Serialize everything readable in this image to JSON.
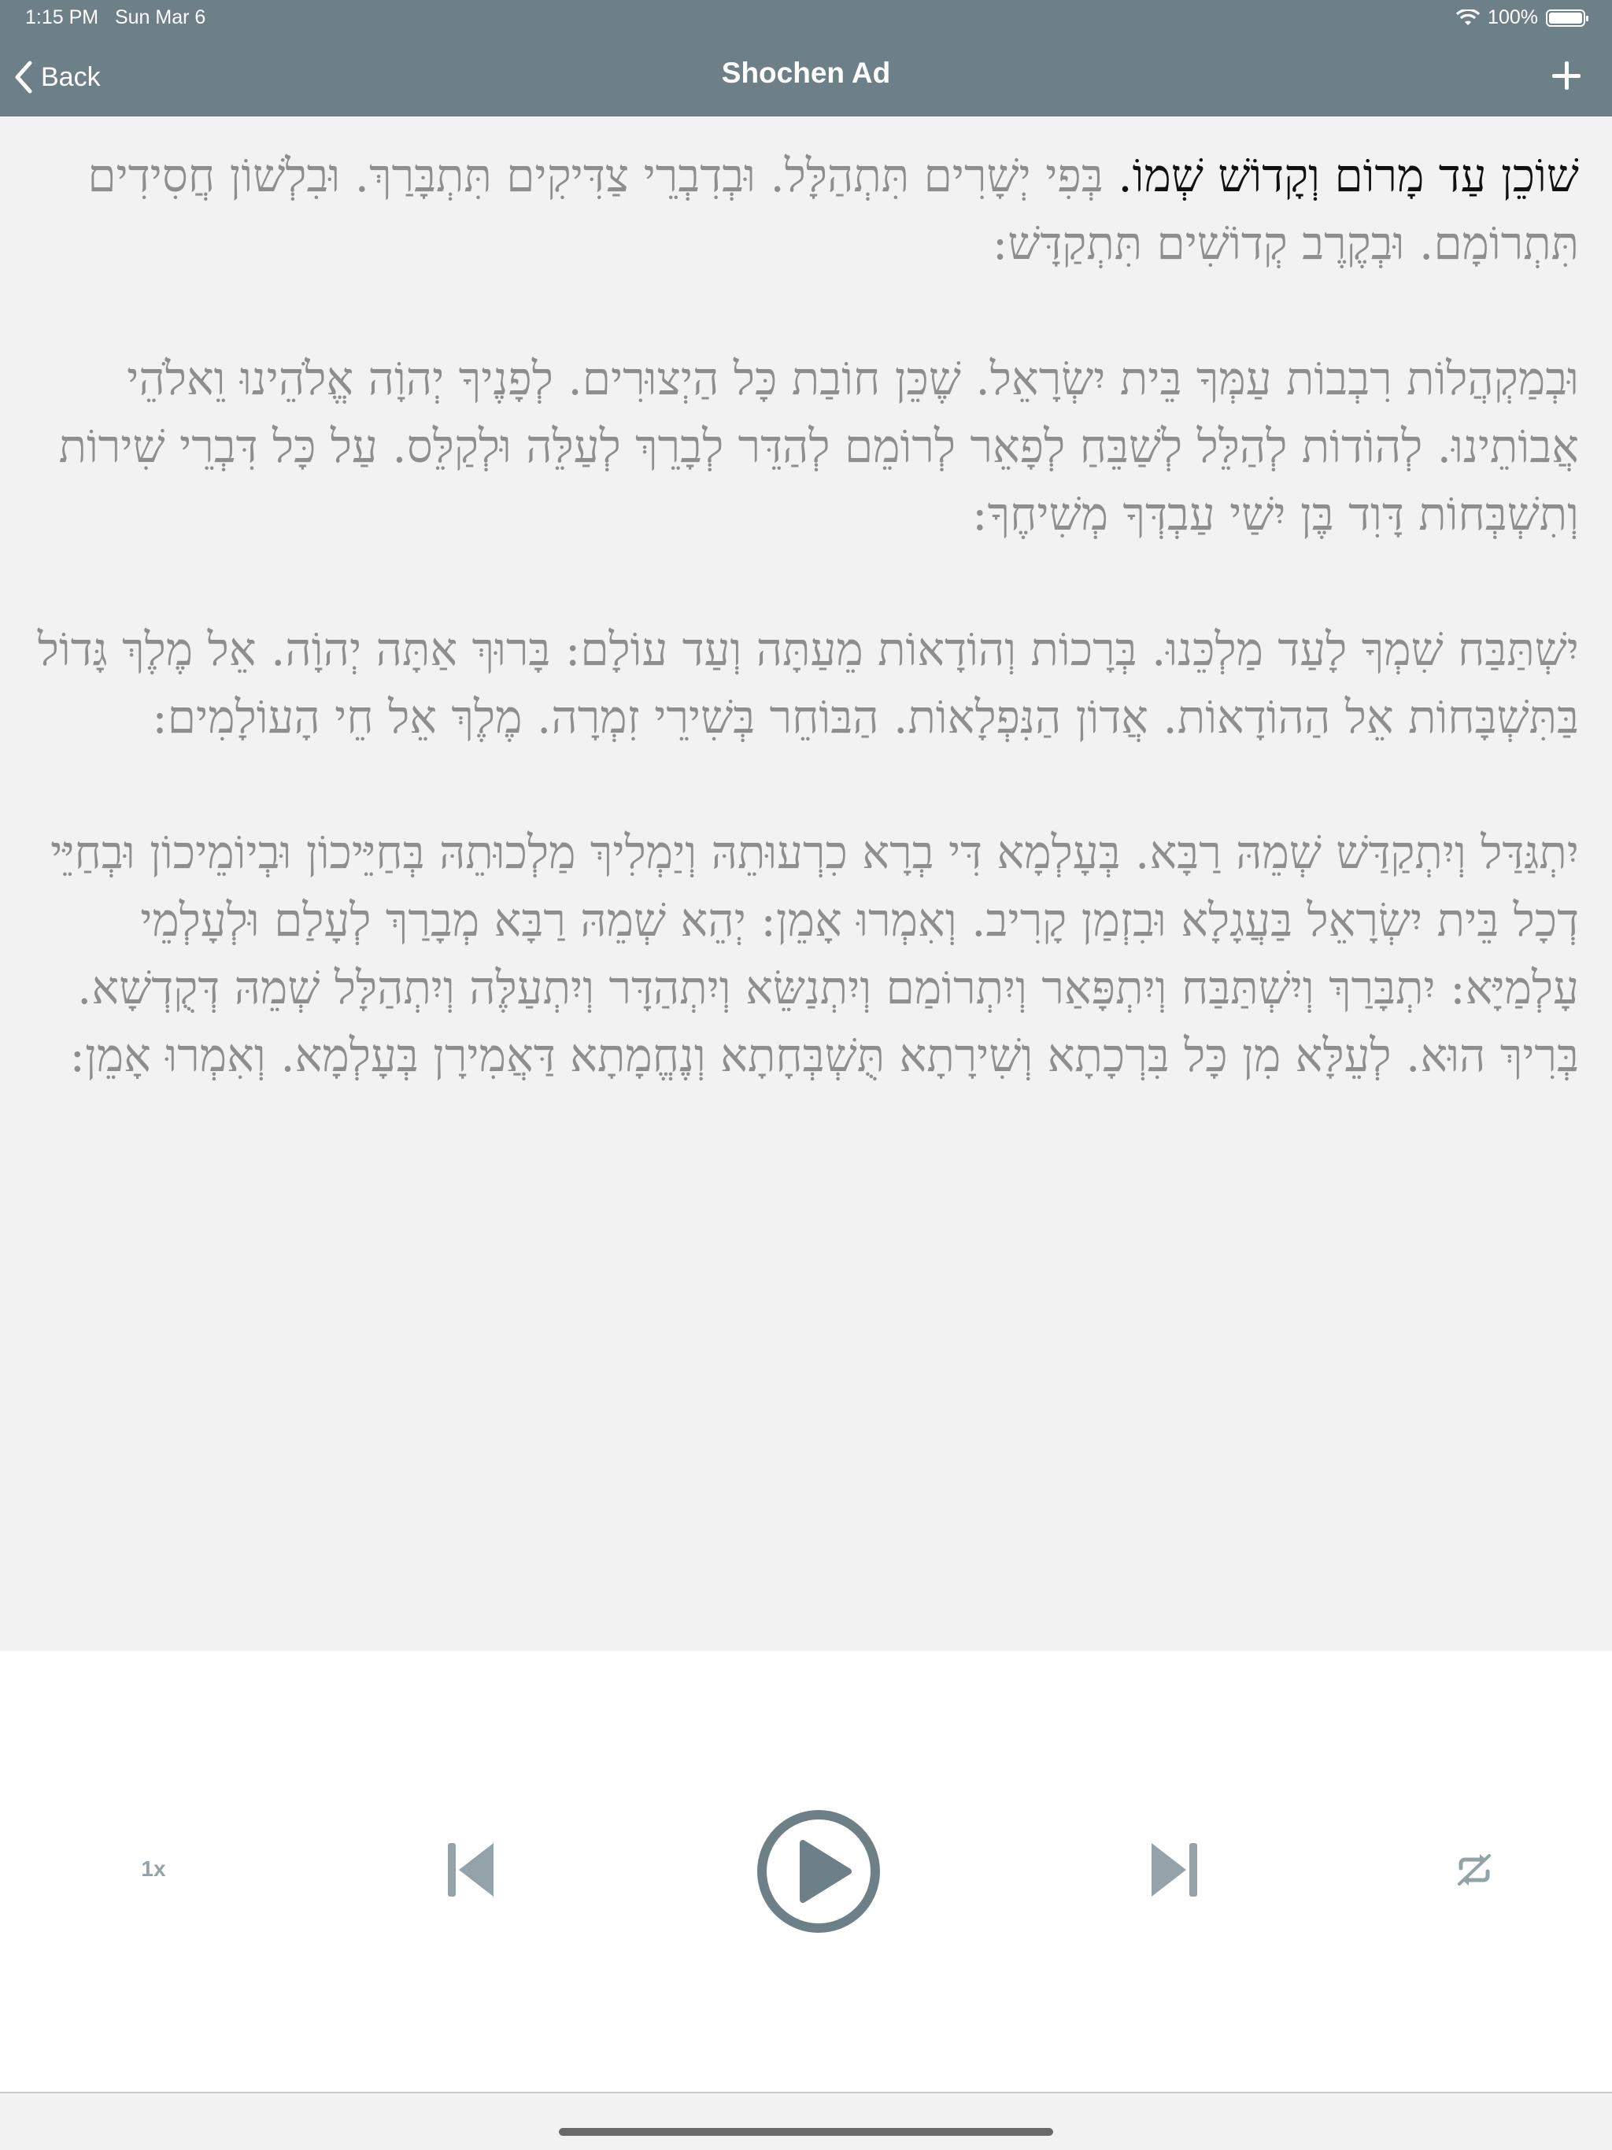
{
  "status_bar": {
    "time": "1:15 PM",
    "date": "Sun Mar 6",
    "battery": "100%",
    "wifi_icon": "wifi-icon",
    "battery_icon": "battery-icon"
  },
  "nav": {
    "back_label": "Back",
    "title": "Shochen Ad",
    "back_icon": "chevron-left-icon",
    "add_icon": "plus-icon"
  },
  "text": {
    "current": "שׁוֹכֵן עַד מָרוֹם וְקָדוֹשׁ שְׁמוֹ.",
    "p1_rest": " בְּפִי יְשָׁרִים תִּתְהַלָּל. וּבְדִבְרֵי צַדִּיקִים תִּתְבָּרַךְ. וּבִלְשׁוֹן חֲסִידִים תִּתְרוֹמָם. וּבְקֶרֶב קְדוֹשִׁים תִּתְקַדָּשׁ:",
    "p2": "וּבְמַקְהֲלוֹת רִבְבוֹת עַמְּךָ בֵּית יִשְׂרָאֵל. שֶׁכֵּן חוֹבַת כָּל הַיְצוּרִים. לְפָנֶיךָ יְהוָֹה אֱלֹהֵינוּ וֵאלֹהֵי אֲבוֹתֵינוּ. לְהוֹדוֹת לְהַלֵּל לְשַׁבֵּחַ לְפָאֵר לְרוֹמֵם לְהַדֵּר לְבָרֵךְ לְעַלֵּה וּלְקַלֵּס. עַל כָּל דִּבְרֵי שִׁירוֹת וְתִשְׁבְּחוֹת דָּוִד בֶּן יִשַׁי עַבְדְּךָ מְשִׁיחֶךָ:",
    "p3": "יִשְׁתַּבַּח שִׁמְךָ לָעַד מַלְכֵּנוּ. בְּרָכוֹת וְהוֹדָאוֹת מֵעַתָּה וְעַד עוֹלָם: בָּרוּךְ אַתָּה יְהוָֹה. אֵל מֶלֶךְ גָּדוֹל בַּתִּשְׁבָּחוֹת אֵל הַהוֹדָאוֹת. אֲדוֹן הַנִּפְלָאוֹת. הַבּוֹחֵר בְּשִׁירֵי זִמְרָה. מֶלֶךְ אֵל חֵי הָעוֹלָמִים:",
    "p4": "יִתְגַּדַּל וְיִתְקַדַּשׁ שְׁמֵהּ רַבָּא. בְּעָלְמָא דִּי בְרָא כִרְעוּתֵהּ וְיַמְלִיךְ מַלְכוּתֵהּ בְּחַיֵּיכוֹן וּבְיוֹמֵיכוֹן וּבְחַיֵּי דְכָל בֵּית יִשְׂרָאֵל בַּעֲגָלָא וּבִזְמַן קָרִיב. וְאִמְרוּ אָמֵן: יְהֵא שְׁמֵהּ רַבָּא מְבָרַךְ לְעָלַם וּלְעָלְמֵי עָלְמַיָּא: יִתְבָּרַךְ וְיִשְׁתַּבַּח וְיִתְפָּאַר וְיִתְרוֹמַם וְיִתְנַשֵּׂא וְיִתְהַדָּר וְיִתְעַלֶּה וְיִתְהַלָּל שְׁמֵהּ דְּקֻדְשָׁא. בְּרִיךְ הוּא. לְעֵלָּא מִן כָּל בִּרְכָתָא וְשִׁירָתָא תֻּשְׁבְּחָתָא וְנֶחֱמָתָא דַּאֲמִירָן בְּעָלְמָא. וְאִמְרוּ אָמֵן:"
  },
  "player": {
    "speed_label": "1x",
    "prev_icon": "skip-back-icon",
    "play_icon": "play-icon",
    "next_icon": "skip-forward-icon",
    "repeat_icon": "repeat-off-icon"
  },
  "colors": {
    "header": "#6d8087",
    "accent": "#6d8087",
    "disabled": "#93a3a9",
    "text_inactive": "#8e8e8e",
    "text_current": "#111111"
  }
}
